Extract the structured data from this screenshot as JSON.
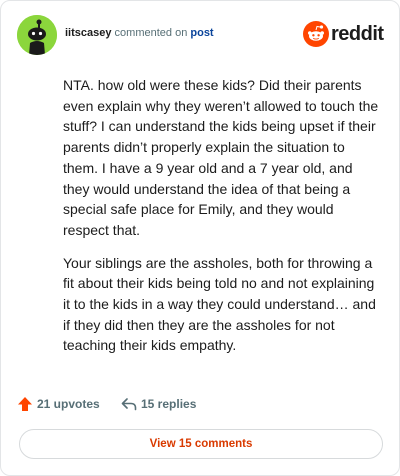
{
  "header": {
    "username": "iitscasey",
    "action_text": "commented on",
    "target_link": "post",
    "logo_text": "reddit",
    "avatar_icon": "snoo-avatar-icon",
    "logo_icon": "reddit-alien-icon"
  },
  "comment": {
    "paragraphs": [
      "NTA. how old were these kids? Did their parents even explain why they weren’t allowed to touch the stuff? I can understand the kids being upset if their parents didn’t properly explain the situation to them. I have a 9 year old and a 7 year old, and they would understand the idea of that being a special safe place for Emily, and they would respect that.",
      "Your siblings are the assholes, both for throwing a fit about their kids being told no and not explaining it to the kids in a way they could understand… and if they did then they are the assholes for not teaching their kids empathy."
    ]
  },
  "actions": {
    "upvotes": "21 upvotes",
    "replies": "15 replies",
    "upvote_icon": "upvote-arrow-icon",
    "reply_icon": "reply-arrow-icon"
  },
  "footer": {
    "view_comments": "View 15 comments"
  },
  "colors": {
    "brand": "#ff4500",
    "link": "#0a449b",
    "accent_text": "#d93a00",
    "avatar_bg": "#8bd63c"
  }
}
